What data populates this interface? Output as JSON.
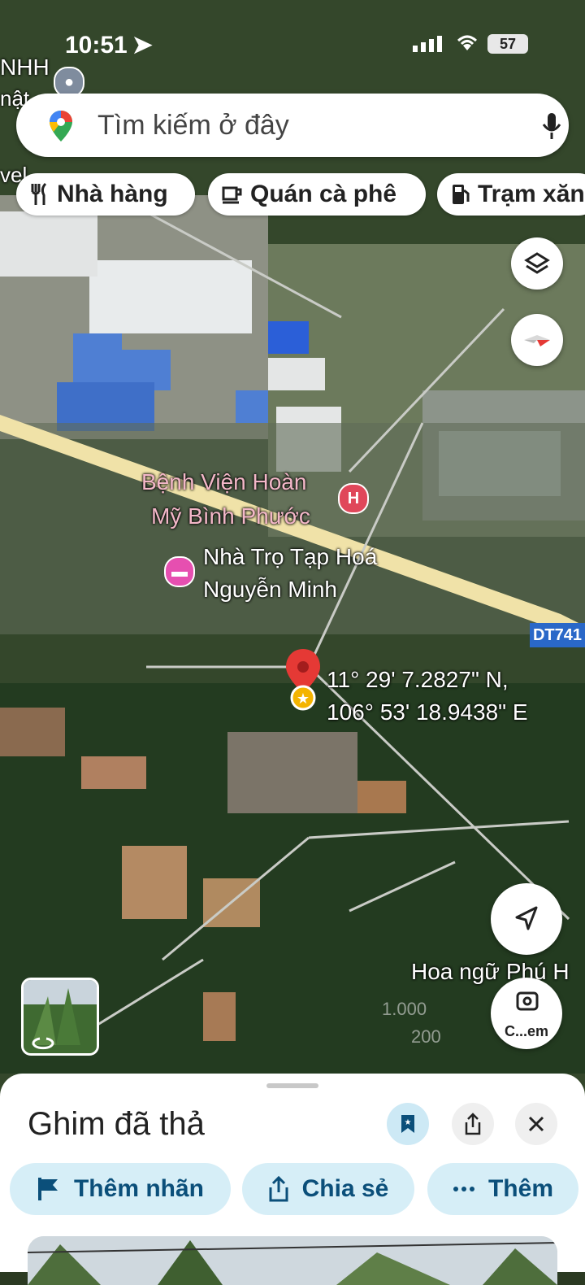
{
  "status_bar": {
    "time": "10:51",
    "battery": "57"
  },
  "search": {
    "placeholder": "Tìm kiếm ở đây"
  },
  "chips": [
    {
      "label": "Nhà hàng",
      "icon": "fork-knife-icon"
    },
    {
      "label": "Quán cà phê",
      "icon": "coffee-cup-icon"
    },
    {
      "label": "Trạm xăn",
      "icon": "gas-station-icon"
    }
  ],
  "map": {
    "top_left_labels": [
      "NHH",
      "nật",
      "vel"
    ],
    "hospital": {
      "line1": "Bệnh Viện Hoàn",
      "line2": "Mỹ Bình Phước",
      "icon": "hospital-icon"
    },
    "hotel": {
      "line1": "Nhà Trọ Tạp Hoá",
      "line2": "Nguyễn Minh",
      "icon": "bed-icon"
    },
    "road_shield": "DT741",
    "pin_coords": {
      "lat": "11° 29' 7.2827\" N,",
      "lng": "106° 53' 18.9438\" E"
    },
    "poi_right": "Hoa ngữ Phú H",
    "scale": {
      "top": "1.000",
      "bottom": "200"
    },
    "lens_label": "C...em"
  },
  "sheet": {
    "title": "Ghim đã thả",
    "actions": [
      {
        "label": "Thêm nhãn",
        "icon": "flag-icon"
      },
      {
        "label": "Chia sẻ",
        "icon": "share-icon"
      },
      {
        "label": "Thêm",
        "icon": "more-dots-icon"
      }
    ]
  },
  "colors": {
    "accent": "#0b4f7a",
    "action_bg": "#d6eef7",
    "pin": "#e53935",
    "hospital": "#e0475a",
    "hotel": "#e64fb0"
  }
}
